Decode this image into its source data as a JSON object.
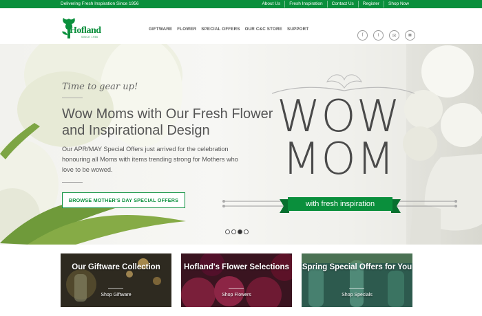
{
  "topbar": {
    "tagline": "Delivering Fresh Inspiration Since 1956",
    "links": [
      "About Us",
      "Fresh Inspiration",
      "Contact Us",
      "Register",
      "Shop Now"
    ]
  },
  "brand": {
    "name": "Hofland",
    "since": "SINCE 1956",
    "color": "#0a8f3c"
  },
  "nav": {
    "items": [
      "GIFTWARE",
      "FLOWER",
      "SPECIAL OFFERS",
      "OUR C&C STORE",
      "SUPPORT"
    ]
  },
  "social": {
    "icons": [
      "facebook-icon",
      "twitter-icon",
      "email-icon",
      "instagram-icon"
    ],
    "glyphs": [
      "f",
      "t",
      "✉",
      "◙"
    ]
  },
  "hero": {
    "kicker": "Time to gear up!",
    "headline": "Wow Moms with Our Fresh Flower and Inspirational Design",
    "body": "Our APR/MAY Special Offers just arrived for the celebration honouring all Moms with items trending strong for Mothers who love to be wowed.",
    "cta": "BROWSE MOTHER'S DAY SPECIAL OFFERS",
    "graphic_title": "WOW MOM",
    "graphic_ribbon": "with fresh inspiration",
    "slides": 4,
    "active_slide": 3
  },
  "tiles": [
    {
      "title": "Our Giftware Collection",
      "link": "Shop Giftware"
    },
    {
      "title": "Hofland's Flower Selections",
      "link": "Shop Flowers"
    },
    {
      "title": "Spring Special Offers for You",
      "link": "Shop Specials"
    }
  ]
}
